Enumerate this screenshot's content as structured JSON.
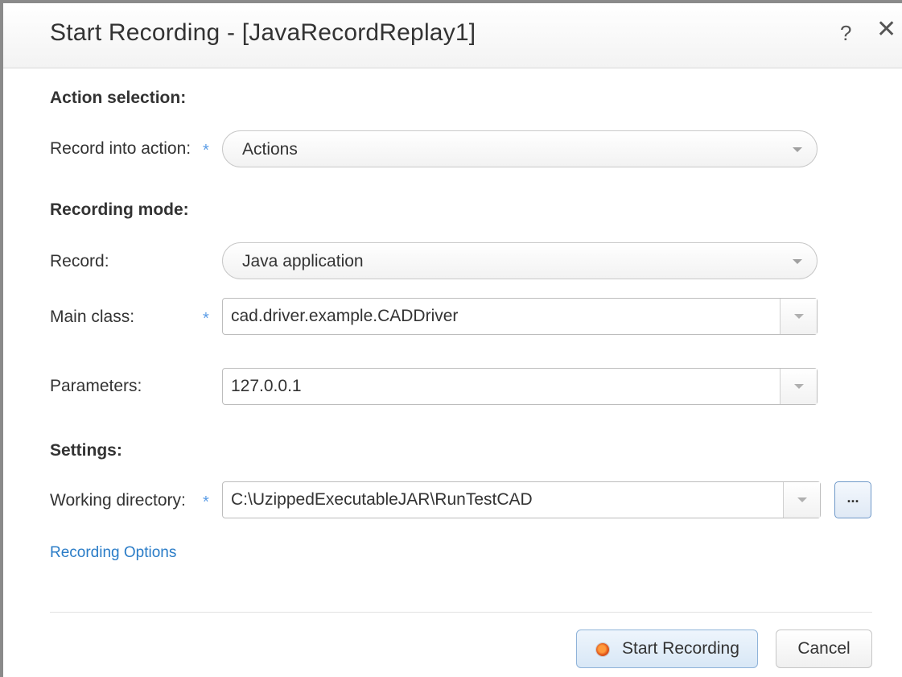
{
  "dialog": {
    "title": "Start Recording - [JavaRecordReplay1]",
    "help_glyph": "?",
    "close_glyph": "✕"
  },
  "action_selection": {
    "heading": "Action selection:",
    "record_into_label": "Record into action:",
    "record_into_value": "Actions"
  },
  "recording_mode": {
    "heading": "Recording mode:",
    "record_label": "Record:",
    "record_value": "Java application",
    "main_class_label": "Main class:",
    "main_class_value": "cad.driver.example.CADDriver",
    "parameters_label": "Parameters:",
    "parameters_value": "127.0.0.1"
  },
  "settings": {
    "heading": "Settings:",
    "working_dir_label": "Working directory:",
    "working_dir_value": "C:\\UzippedExecutableJAR\\RunTestCAD",
    "browse_label": "..."
  },
  "required_marker": "*",
  "links": {
    "recording_options": "Recording Options"
  },
  "footer": {
    "start_label": "Start Recording",
    "cancel_label": "Cancel"
  },
  "icons": {
    "help": "help-icon",
    "close": "close-icon",
    "dropdown": "chevron-down-icon",
    "record": "record-dot-icon"
  },
  "colors": {
    "required": "#5a9ce6",
    "link": "#2a7cc7",
    "primary_border": "#8fb3d9",
    "record_dot": "#e0541a"
  }
}
